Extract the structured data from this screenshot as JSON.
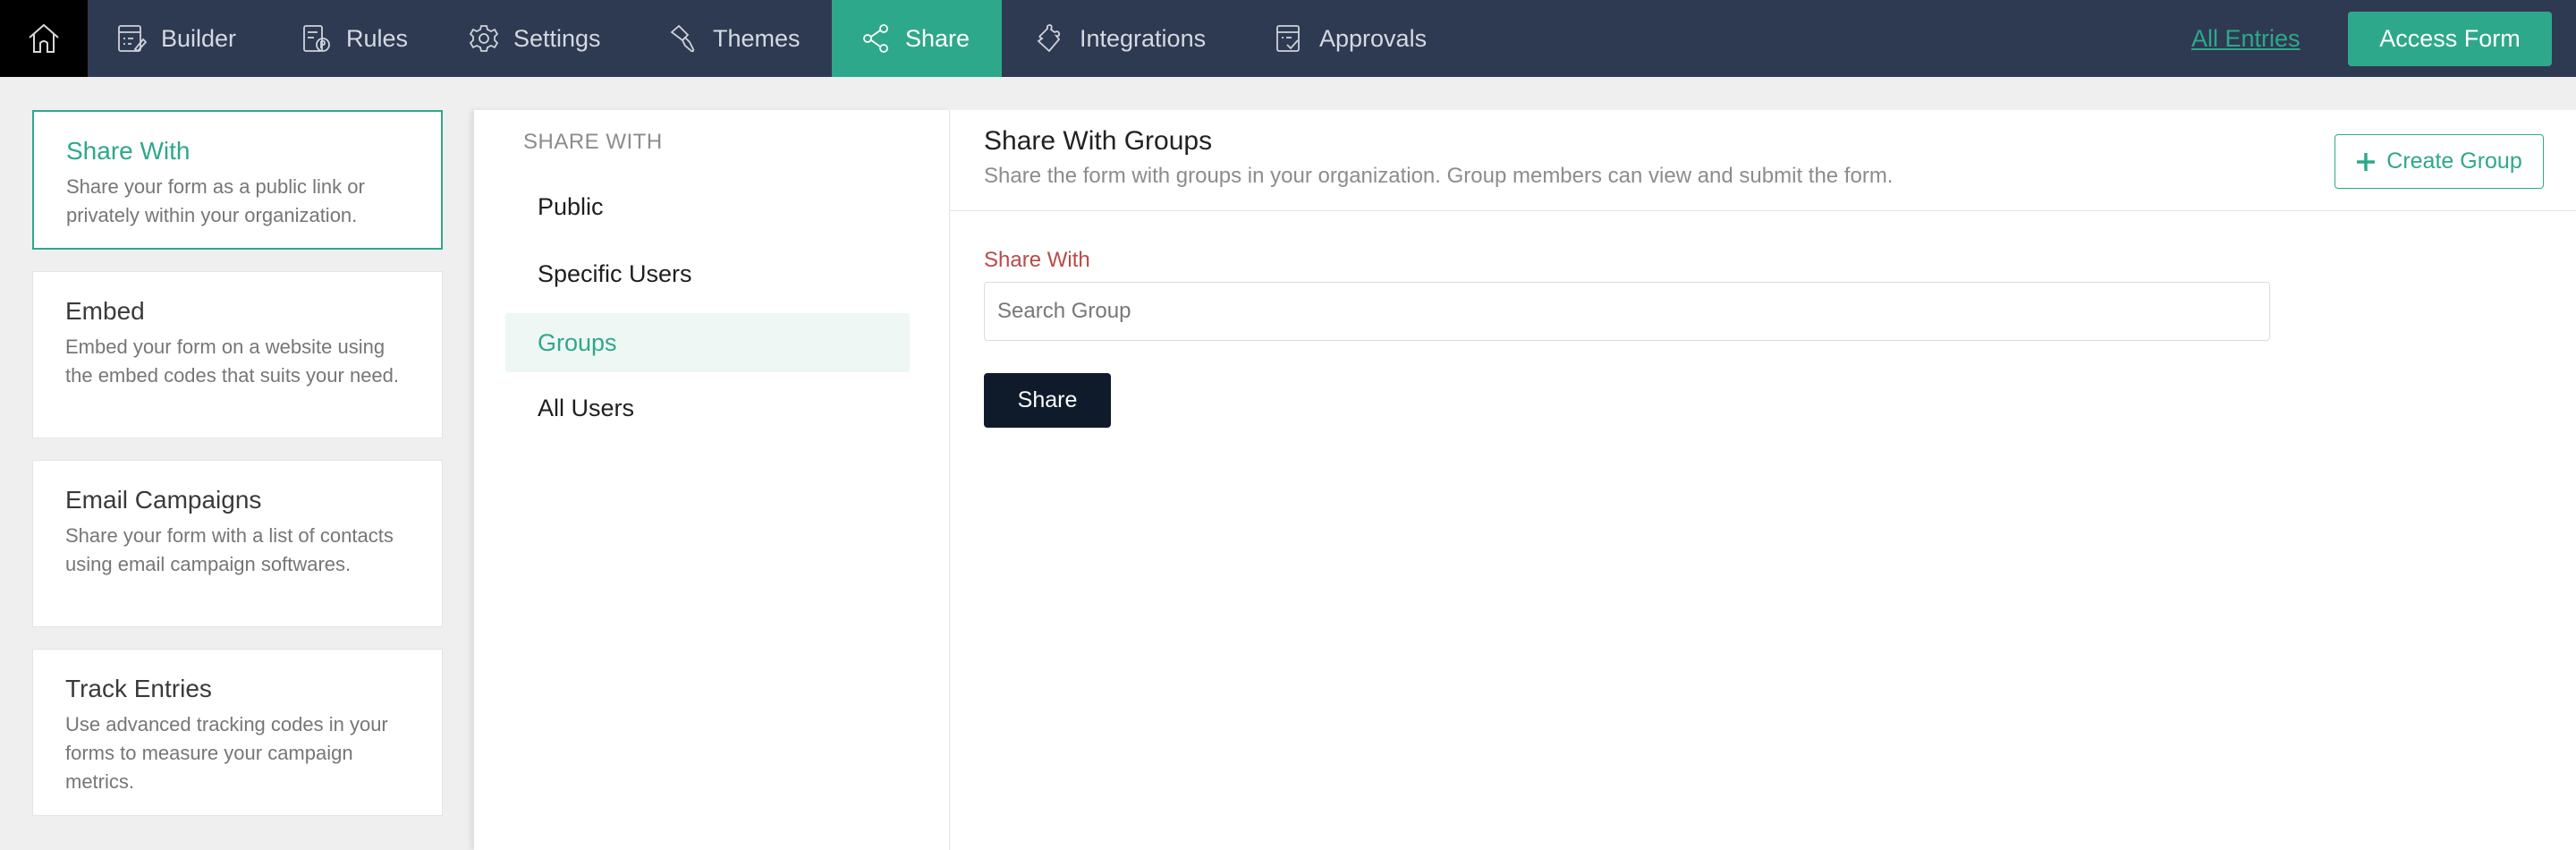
{
  "topbar": {
    "home_icon": "home-icon",
    "nav": [
      {
        "label": "Builder",
        "icon": "builder-icon",
        "active": false
      },
      {
        "label": "Rules",
        "icon": "rules-icon",
        "active": false
      },
      {
        "label": "Settings",
        "icon": "gear-icon",
        "active": false
      },
      {
        "label": "Themes",
        "icon": "paint-brush-icon",
        "active": false
      },
      {
        "label": "Share",
        "icon": "share-icon",
        "active": true
      },
      {
        "label": "Integrations",
        "icon": "puzzle-icon",
        "active": false
      },
      {
        "label": "Approvals",
        "icon": "approvals-icon",
        "active": false
      }
    ],
    "all_entries_label": "All Entries",
    "access_form_label": "Access Form"
  },
  "share_options": [
    {
      "title": "Share With",
      "description": "Share your form as a public link or privately within your organization.",
      "active": true
    },
    {
      "title": "Embed",
      "description": "Embed your form on a website using the embed codes that suits your need.",
      "active": false
    },
    {
      "title": "Email Campaigns",
      "description": "Share your form with a list of contacts using email campaign softwares.",
      "active": false
    },
    {
      "title": "Track Entries",
      "description": "Use advanced tracking codes in your forms to measure your campaign metrics.",
      "active": false
    }
  ],
  "share_with_menu": {
    "heading": "SHARE WITH",
    "items": [
      {
        "label": "Public",
        "active": false
      },
      {
        "label": "Specific Users",
        "active": false
      },
      {
        "label": "Groups",
        "active": true
      },
      {
        "label": "All Users",
        "active": false
      }
    ]
  },
  "groups_panel": {
    "title": "Share With Groups",
    "subtitle": "Share the form with groups in your organization. Group members can view and submit the form.",
    "create_group_label": "Create Group",
    "field_label": "Share With",
    "search_placeholder": "Search Group",
    "search_value": "",
    "share_button_label": "Share"
  },
  "colors": {
    "accent": "#2ea88a",
    "topbar_bg": "#2e3a52",
    "required_label": "#b94a48",
    "primary_button": "#0f1b2b"
  }
}
